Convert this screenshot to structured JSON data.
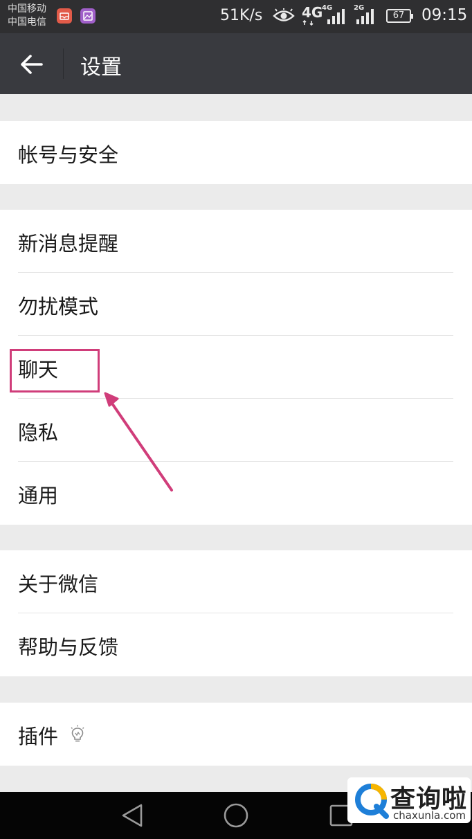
{
  "status_bar": {
    "carrier_1": "中国移动",
    "carrier_2": "中国电信",
    "network_speed": "51K/s",
    "network_4g": "4G",
    "network_4g_small": "4G",
    "network_2g": "2G",
    "battery": "67",
    "time": "09:15"
  },
  "toolbar": {
    "title": "设置"
  },
  "groups": [
    {
      "items": [
        {
          "label": "帐号与安全"
        }
      ]
    },
    {
      "items": [
        {
          "label": "新消息提醒"
        },
        {
          "label": "勿扰模式"
        },
        {
          "label": "聊天"
        },
        {
          "label": "隐私"
        },
        {
          "label": "通用"
        }
      ]
    },
    {
      "items": [
        {
          "label": "关于微信"
        },
        {
          "label": "帮助与反馈"
        }
      ]
    },
    {
      "items": [
        {
          "label": "插件"
        }
      ]
    }
  ],
  "annotation": {
    "highlighted_item": "聊天",
    "color": "#d03d7a"
  },
  "watermark": {
    "text": "查询啦",
    "url": "chaxunla.com"
  }
}
